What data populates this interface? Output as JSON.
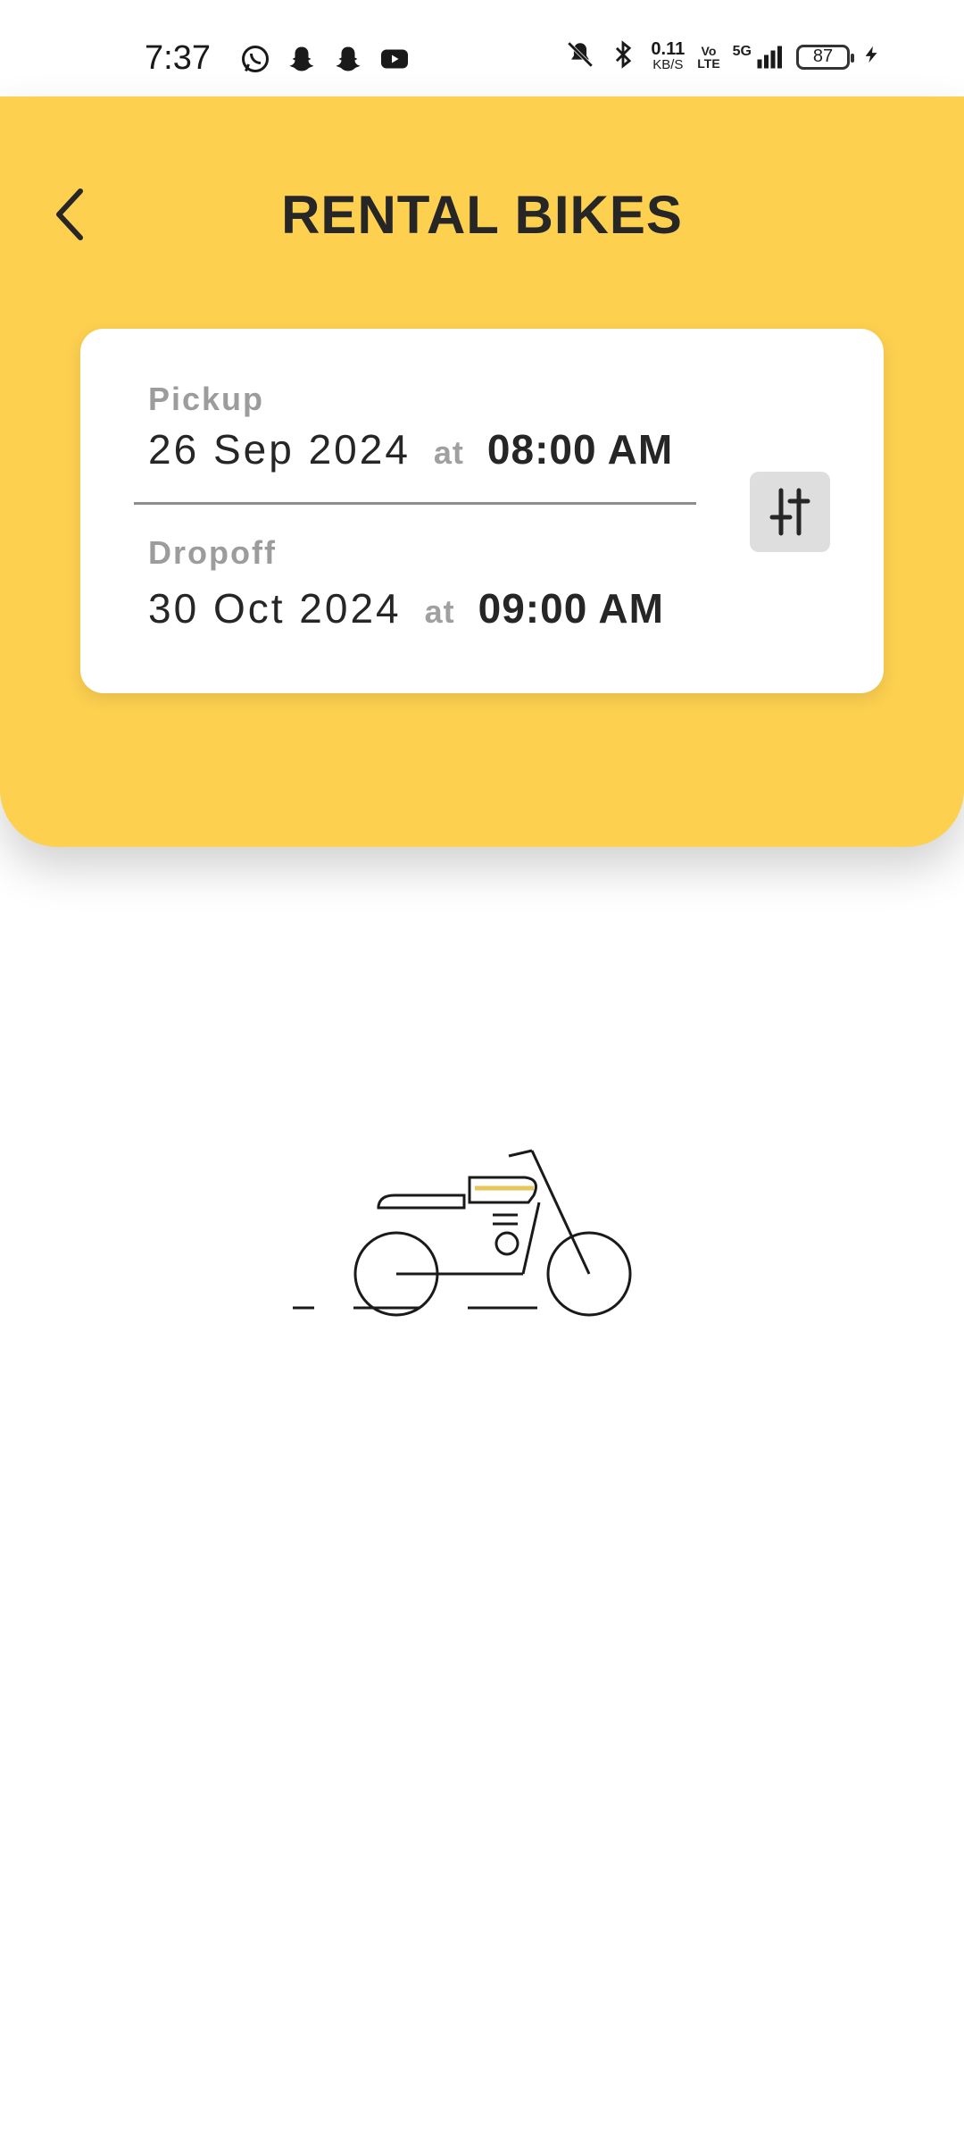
{
  "status_bar": {
    "time": "7:37",
    "net_speed_value": "0.11",
    "net_speed_unit": "KB/S",
    "volte_top": "Vo",
    "volte_bottom": "LTE",
    "network": "5G",
    "battery": "87"
  },
  "header": {
    "title": "RENTAL BIKES",
    "bg_color": "#FDD050"
  },
  "booking": {
    "pickup": {
      "label": "Pickup",
      "date": "26 Sep 2024",
      "at": "at",
      "time": "08:00 AM"
    },
    "dropoff": {
      "label": "Dropoff",
      "date": "30 Oct 2024",
      "at": "at",
      "time": "09:00 AM"
    }
  },
  "icons": {
    "back": "chevron-left-icon",
    "filter": "sliders-icon",
    "illustration": "motorcycle-icon"
  }
}
